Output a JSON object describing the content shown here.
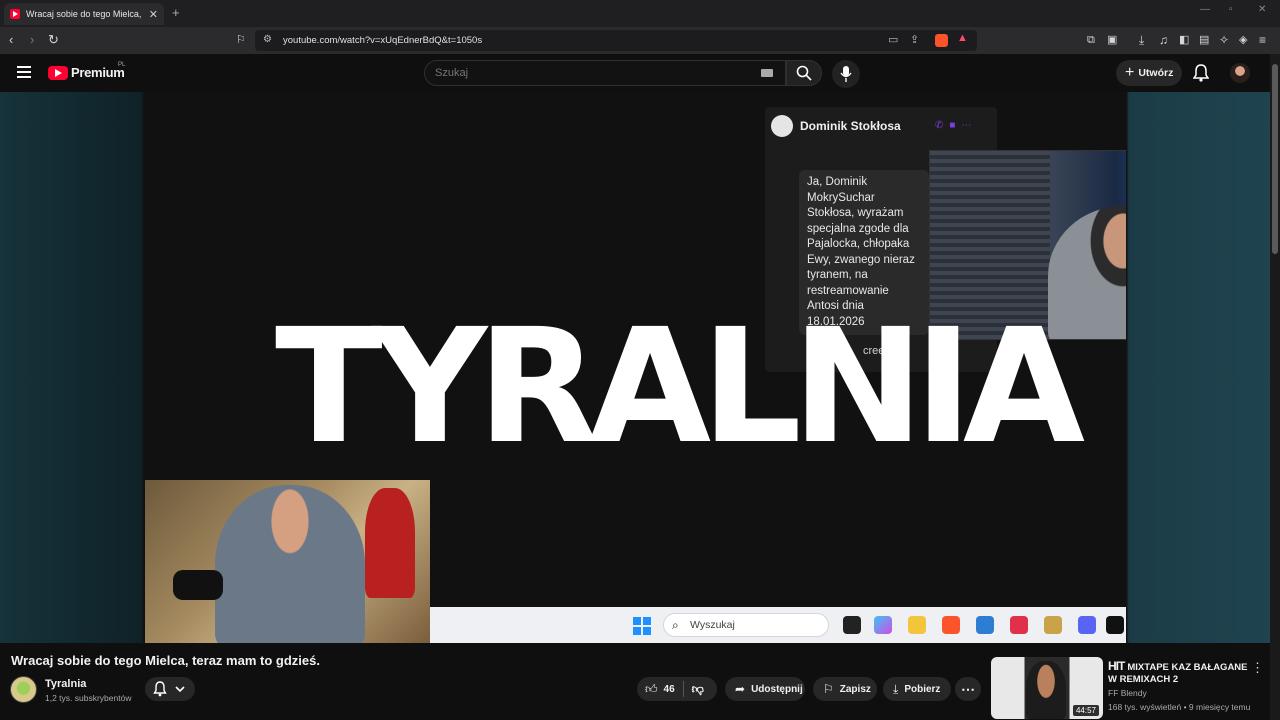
{
  "browser": {
    "tab_title": "Wracaj sobie do tego Mielca, te",
    "tab_close": "✕",
    "new_tab": "+",
    "url": "youtube.com/watch?v=xUqEdnerBdQ&t=1050s"
  },
  "youtube": {
    "logo_text": "Premium",
    "country_code": "PL",
    "search_placeholder": "Szukaj",
    "create_label": "Utwórz"
  },
  "video_content": {
    "chat_name": "Dominik Stokłosa",
    "chat_message": "Ja, Dominik MokrySuchar Stokłosa, wyrażam specjalna zgode dla Pajalocka, chłopaka Ewy, zwanego nieraz tyranem, na restreamowanie Antosi dnia 18.01.2026",
    "chat_more": "creen",
    "big_title": "TYRALNIA",
    "taskbar_search": "Wyszukaj"
  },
  "video": {
    "title": "Wracaj sobie do tego Mielca, teraz mam to gdzieś.",
    "channel_name": "Tyralnia",
    "subscribers": "1,2 tys. subskrybentów",
    "likes": "46",
    "share_label": "Udostępnij",
    "save_label": "Zapisz",
    "download_label": "Pobierz"
  },
  "recommendation": {
    "title_hit": "HIT",
    "title": "MIXTAPE KAZ BAŁAGANE W REMIXACH 2",
    "channel": "FF Blendy",
    "meta": "168 tys. wyświetleń • 9 miesięcy temu",
    "duration": "44:57"
  },
  "colors": {
    "youtube_red": "#ff0033",
    "background": "#0f0f0f",
    "windows_blue": "#1e90ff"
  }
}
